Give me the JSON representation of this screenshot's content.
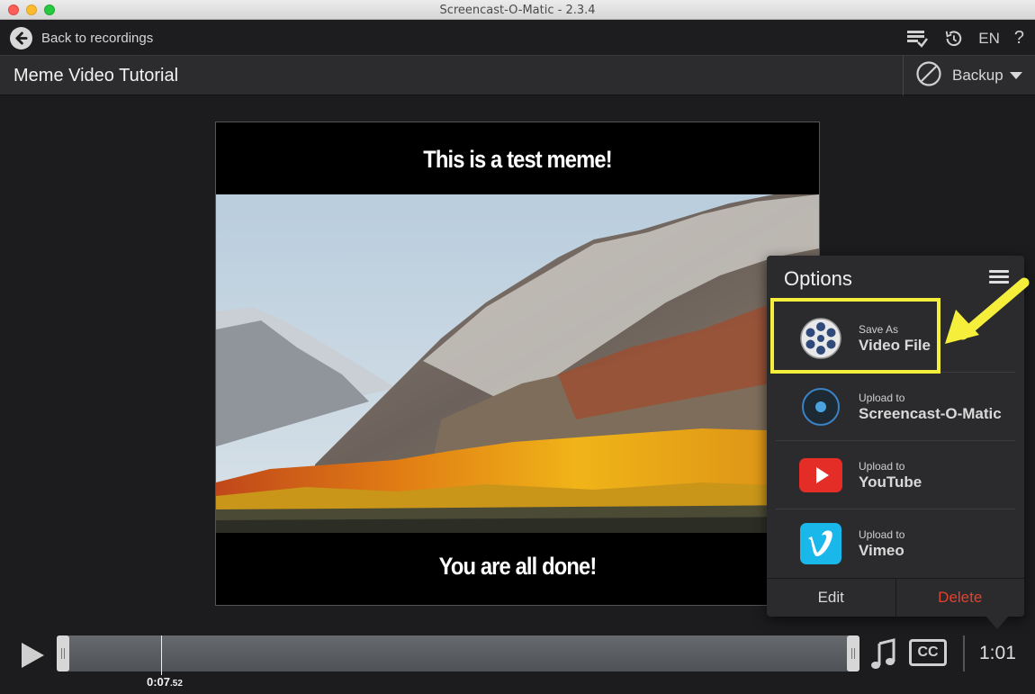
{
  "window": {
    "title": "Screencast-O-Matic - 2.3.4"
  },
  "topbar": {
    "back_label": "Back to recordings",
    "language": "EN",
    "help": "?"
  },
  "header": {
    "project_title": "Meme Video Tutorial",
    "backup_label": "Backup"
  },
  "video": {
    "top_caption": "This is a test meme!",
    "bottom_caption": "You are all done!"
  },
  "options": {
    "title": "Options",
    "items": [
      {
        "small": "Save As",
        "big": "Video File",
        "icon": "film-reel-icon"
      },
      {
        "small": "Upload to",
        "big": "Screencast-O-Matic",
        "icon": "screencast-o-matic-icon"
      },
      {
        "small": "Upload to",
        "big": "YouTube",
        "icon": "youtube-icon"
      },
      {
        "small": "Upload to",
        "big": "Vimeo",
        "icon": "vimeo-icon"
      }
    ],
    "edit_label": "Edit",
    "delete_label": "Delete"
  },
  "playback": {
    "current_time": "0:07",
    "current_fraction": ".52",
    "duration": "1:01",
    "cc_label": "CC",
    "playhead_fraction": 0.13
  },
  "colors": {
    "highlight": "#f5ef3c",
    "delete": "#e0422e",
    "youtube": "#e52d27",
    "vimeo": "#1ab7ea"
  }
}
